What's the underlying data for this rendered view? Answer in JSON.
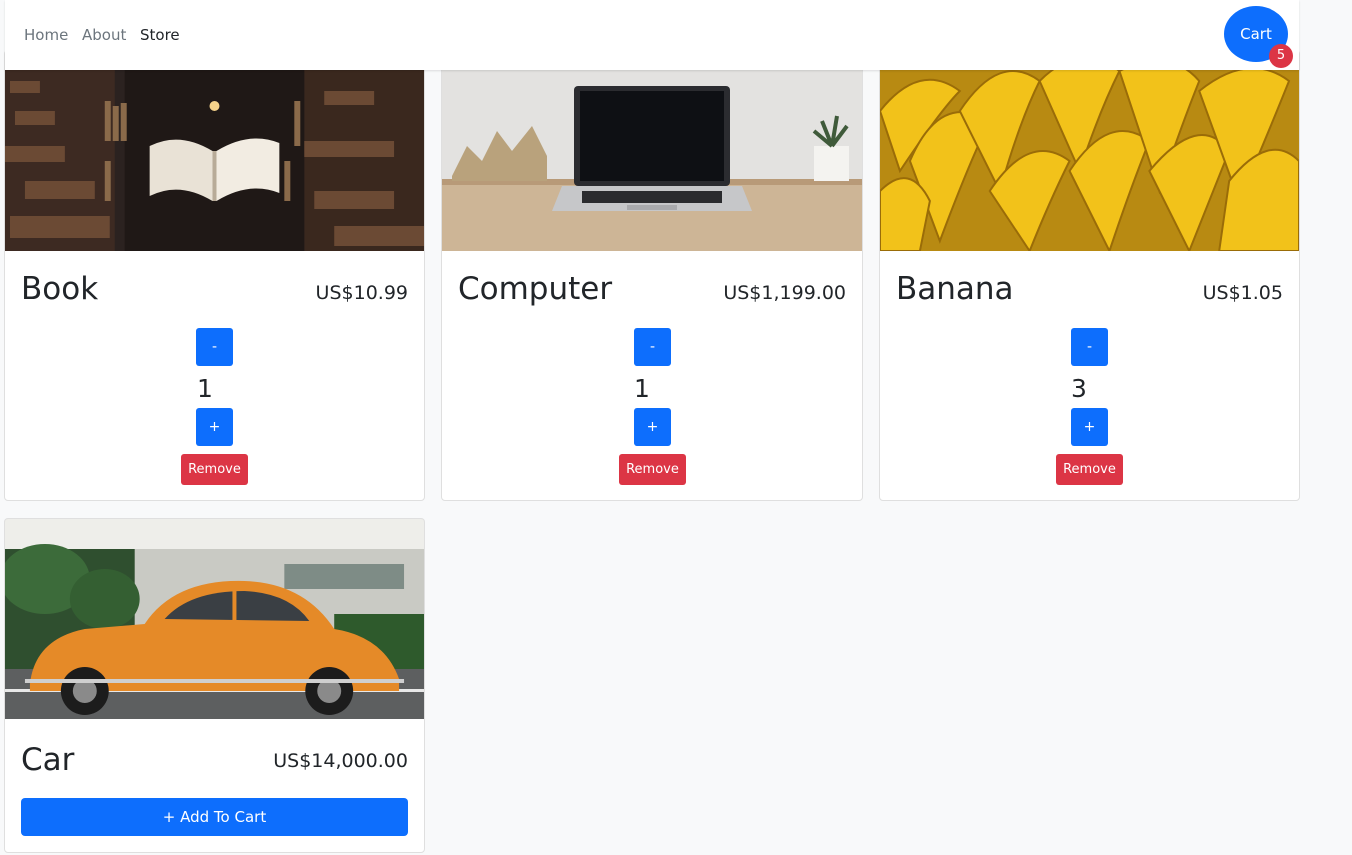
{
  "nav": {
    "links": [
      {
        "label": "Home"
      },
      {
        "label": "About"
      },
      {
        "label": "Store"
      }
    ],
    "cart_label": "Cart",
    "cart_count": "5"
  },
  "colors": {
    "primary": "#0d6efd",
    "danger": "#dc3545",
    "background": "#f8f9fa"
  },
  "products": [
    {
      "name": "Book",
      "price": "US$10.99",
      "quantity": "1",
      "minus": "-",
      "plus": "+",
      "remove": "Remove",
      "image": "floating-book-library-image"
    },
    {
      "name": "Computer",
      "price": "US$1,199.00",
      "quantity": "1",
      "minus": "-",
      "plus": "+",
      "remove": "Remove",
      "image": "laptop-on-desk-image"
    },
    {
      "name": "Banana",
      "price": "US$1.05",
      "quantity": "3",
      "minus": "-",
      "plus": "+",
      "remove": "Remove",
      "image": "bananas-image"
    },
    {
      "name": "Car",
      "price": "US$14,000.00",
      "add_to_cart": "+ Add To Cart",
      "image": "orange-beetle-car-image"
    }
  ]
}
